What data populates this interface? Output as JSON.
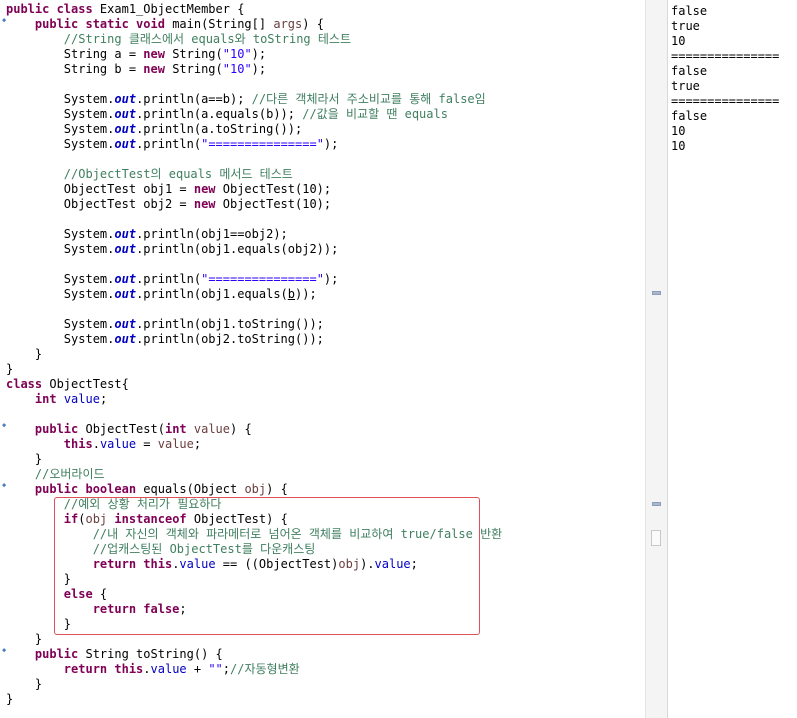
{
  "editor": {
    "lines": [
      [
        {
          "t": "public class ",
          "c": "kw"
        },
        {
          "t": "Exam1_ObjectMember {",
          "c": "pl"
        }
      ],
      [
        {
          "t": "    "
        },
        {
          "t": "public static void ",
          "c": "kw"
        },
        {
          "t": "main(String[] ",
          "c": "pl"
        },
        {
          "t": "args",
          "c": "pm"
        },
        {
          "t": ") {",
          "c": "pl"
        }
      ],
      [
        {
          "t": "        //String 클래스에서 equals와 toString 테스트",
          "c": "cm"
        }
      ],
      [
        {
          "t": "        String a = "
        },
        {
          "t": "new ",
          "c": "kw"
        },
        {
          "t": "String("
        },
        {
          "t": "\"10\"",
          "c": "st"
        },
        {
          "t": ");"
        }
      ],
      [
        {
          "t": "        String b = "
        },
        {
          "t": "new ",
          "c": "kw"
        },
        {
          "t": "String("
        },
        {
          "t": "\"10\"",
          "c": "st"
        },
        {
          "t": ");"
        }
      ],
      [],
      [
        {
          "t": "        System."
        },
        {
          "t": "out",
          "c": "sf"
        },
        {
          "t": ".println(a==b); "
        },
        {
          "t": "//다른 객체라서 주소비교를 통해 false임",
          "c": "cm"
        }
      ],
      [
        {
          "t": "        System."
        },
        {
          "t": "out",
          "c": "sf"
        },
        {
          "t": ".println(a.equals(b)); "
        },
        {
          "t": "//값을 비교할 땐 equals",
          "c": "cm"
        }
      ],
      [
        {
          "t": "        System."
        },
        {
          "t": "out",
          "c": "sf"
        },
        {
          "t": ".println(a.toString());"
        }
      ],
      [
        {
          "t": "        System."
        },
        {
          "t": "out",
          "c": "sf"
        },
        {
          "t": ".println("
        },
        {
          "t": "\"===============\"",
          "c": "st"
        },
        {
          "t": ");"
        }
      ],
      [],
      [
        {
          "t": "        //ObjectTest의 equals 메서드 테스트",
          "c": "cm"
        }
      ],
      [
        {
          "t": "        ObjectTest obj1 = "
        },
        {
          "t": "new ",
          "c": "kw"
        },
        {
          "t": "ObjectTest(10);"
        }
      ],
      [
        {
          "t": "        ObjectTest obj2 = "
        },
        {
          "t": "new ",
          "c": "kw"
        },
        {
          "t": "ObjectTest(10);"
        }
      ],
      [],
      [
        {
          "t": "        System."
        },
        {
          "t": "out",
          "c": "sf"
        },
        {
          "t": ".println(obj1==obj2);"
        }
      ],
      [
        {
          "t": "        System."
        },
        {
          "t": "out",
          "c": "sf"
        },
        {
          "t": ".println(obj1.equals(obj2));"
        }
      ],
      [],
      [
        {
          "t": "        System."
        },
        {
          "t": "out",
          "c": "sf"
        },
        {
          "t": ".println("
        },
        {
          "t": "\"===============\"",
          "c": "st"
        },
        {
          "t": ");"
        }
      ],
      [
        {
          "t": "        System."
        },
        {
          "t": "out",
          "c": "sf"
        },
        {
          "t": ".println(obj1.equals("
        },
        {
          "t": "b",
          "c": "ul"
        },
        {
          "t": "));"
        }
      ],
      [],
      [
        {
          "t": "        System."
        },
        {
          "t": "out",
          "c": "sf"
        },
        {
          "t": ".println(obj1.toString());"
        }
      ],
      [
        {
          "t": "        System."
        },
        {
          "t": "out",
          "c": "sf"
        },
        {
          "t": ".println(obj2.toString());"
        }
      ],
      [
        {
          "t": "    }"
        }
      ],
      [
        {
          "t": "}"
        }
      ],
      [
        {
          "t": "class ",
          "c": "kw"
        },
        {
          "t": "ObjectTest{"
        }
      ],
      [
        {
          "t": "    "
        },
        {
          "t": "int ",
          "c": "kw"
        },
        {
          "t": "value",
          "c": "fd"
        },
        {
          "t": ";"
        }
      ],
      [],
      [
        {
          "t": "    "
        },
        {
          "t": "public ",
          "c": "kw"
        },
        {
          "t": "ObjectTest("
        },
        {
          "t": "int ",
          "c": "kw"
        },
        {
          "t": "value",
          "c": "pm"
        },
        {
          "t": ") {"
        }
      ],
      [
        {
          "t": "        "
        },
        {
          "t": "this",
          "c": "kw"
        },
        {
          "t": "."
        },
        {
          "t": "value",
          "c": "fd"
        },
        {
          "t": " = "
        },
        {
          "t": "value",
          "c": "pm"
        },
        {
          "t": ";"
        }
      ],
      [
        {
          "t": "    }"
        }
      ],
      [
        {
          "t": "    //오버라이드",
          "c": "cm"
        }
      ],
      [
        {
          "t": "    "
        },
        {
          "t": "public boolean ",
          "c": "kw"
        },
        {
          "t": "equals(Object "
        },
        {
          "t": "obj",
          "c": "pm"
        },
        {
          "t": ") {"
        }
      ],
      [
        {
          "t": "        //예외 상황 처리가 필요하다",
          "c": "cm"
        }
      ],
      [
        {
          "t": "        "
        },
        {
          "t": "if",
          "c": "kw"
        },
        {
          "t": "("
        },
        {
          "t": "obj ",
          "c": "pm"
        },
        {
          "t": "instanceof ",
          "c": "kw"
        },
        {
          "t": "ObjectTest) {"
        }
      ],
      [
        {
          "t": "            //내 자신의 객체와 파라메터로 넘어온 객체를 비교하여 true/false 반환",
          "c": "cm"
        }
      ],
      [
        {
          "t": "            //업캐스팅된 ObjectTest를 다운캐스팅",
          "c": "cm"
        }
      ],
      [
        {
          "t": "            "
        },
        {
          "t": "return this",
          "c": "kw"
        },
        {
          "t": "."
        },
        {
          "t": "value",
          "c": "fd"
        },
        {
          "t": " == ((ObjectTest)"
        },
        {
          "t": "obj",
          "c": "pm"
        },
        {
          "t": ")."
        },
        {
          "t": "value",
          "c": "fd"
        },
        {
          "t": ";"
        }
      ],
      [
        {
          "t": "        }"
        }
      ],
      [
        {
          "t": "        "
        },
        {
          "t": "else ",
          "c": "kw"
        },
        {
          "t": "{"
        }
      ],
      [
        {
          "t": "            "
        },
        {
          "t": "return false",
          "c": "kw"
        },
        {
          "t": ";"
        }
      ],
      [
        {
          "t": "        }"
        }
      ],
      [
        {
          "t": "    }"
        }
      ],
      [
        {
          "t": "    "
        },
        {
          "t": "public ",
          "c": "kw"
        },
        {
          "t": "String toString() {"
        }
      ],
      [
        {
          "t": "        "
        },
        {
          "t": "return this",
          "c": "kw"
        },
        {
          "t": "."
        },
        {
          "t": "value",
          "c": "fd"
        },
        {
          "t": " + "
        },
        {
          "t": "\"\"",
          "c": "st"
        },
        {
          "t": ";"
        },
        {
          "t": "//자동형변환",
          "c": "cm"
        }
      ],
      [
        {
          "t": "    }"
        }
      ],
      [
        {
          "t": "}"
        }
      ]
    ]
  },
  "console": {
    "lines": [
      "false",
      "true",
      "10",
      "===============",
      "false",
      "true",
      "===============",
      "false",
      "10",
      "10"
    ]
  },
  "colors": {
    "keyword": "#7f0055",
    "comment": "#3f7f5f",
    "string": "#2a00ff",
    "field": "#0000c0",
    "parameter": "#6a3e3e",
    "highlight_border": "#e0505a"
  },
  "icons": {
    "fold_marker": "fold-arrow-icon",
    "overview_mark": "ruler-mark-icon"
  }
}
